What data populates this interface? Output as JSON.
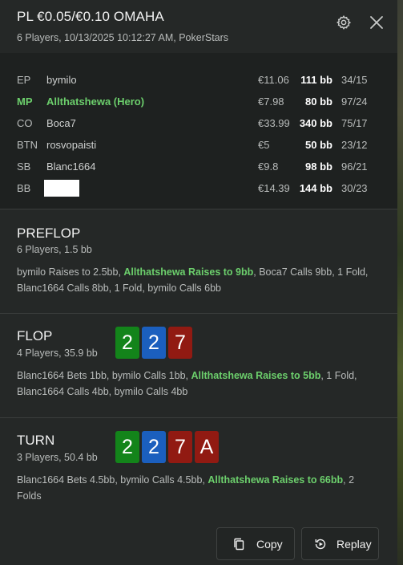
{
  "header": {
    "title": "PL €0.05/€0.10 OMAHA",
    "subtitle": "6 Players, 10/13/2025 10:12:27 AM, PokerStars"
  },
  "players": [
    {
      "position": "EP",
      "name": "bymilo",
      "stack": "€11.06",
      "bb": "111 bb",
      "stats": "34/15",
      "hero": false
    },
    {
      "position": "MP",
      "name": "Allthatshewa (Hero)",
      "stack": "€7.98",
      "bb": "80 bb",
      "stats": "97/24",
      "hero": true
    },
    {
      "position": "CO",
      "name": "Boca7",
      "stack": "€33.99",
      "bb": "340 bb",
      "stats": "75/17",
      "hero": false
    },
    {
      "position": "BTN",
      "name": "rosvopaisti",
      "stack": "€5",
      "bb": "50 bb",
      "stats": "23/12",
      "hero": false
    },
    {
      "position": "SB",
      "name": "Blanc1664",
      "stack": "€9.8",
      "bb": "98 bb",
      "stats": "96/21",
      "hero": false
    },
    {
      "position": "BB",
      "name": "",
      "stack": "€14.39",
      "bb": "144 bb",
      "stats": "30/23",
      "hero": false
    }
  ],
  "preflop": {
    "name": "PREFLOP",
    "info": "6 Players, 1.5 bb",
    "action_1": "bymilo Raises to 2.5bb, ",
    "hero_action": "Allthatshewa Raises to 9bb",
    "action_2": ", Boca7 Calls 9bb, 1 Fold, Blanc1664 Calls 8bb, 1 Fold, bymilo Calls 6bb"
  },
  "flop": {
    "name": "FLOP",
    "info": "4 Players, 35.9 bb",
    "cards": [
      {
        "rank": "2",
        "suit": "club",
        "color": "#13841a"
      },
      {
        "rank": "2",
        "suit": "diamond",
        "color": "#1b5fbe"
      },
      {
        "rank": "7",
        "suit": "heart",
        "color": "#911a12"
      }
    ],
    "action_1": "Blanc1664 Bets 1bb, bymilo Calls 1bb, ",
    "hero_action": "Allthatshewa Raises to 5bb",
    "action_2": ", 1 Fold, Blanc1664 Calls 4bb, bymilo Calls 4bb"
  },
  "turn": {
    "name": "TURN",
    "info": "3 Players, 50.4 bb",
    "cards": [
      {
        "rank": "2",
        "suit": "club",
        "color": "#13841a"
      },
      {
        "rank": "2",
        "suit": "diamond",
        "color": "#1b5fbe"
      },
      {
        "rank": "7",
        "suit": "heart",
        "color": "#911a12"
      },
      {
        "rank": "A",
        "suit": "heart",
        "color": "#911a12"
      }
    ],
    "action_1": "Blanc1664 Bets 4.5bb, bymilo Calls 4.5bb, ",
    "hero_action": "Allthatshewa Raises to 66bb",
    "action_2": ", 2 Folds"
  },
  "buttons": {
    "copy": "Copy",
    "replay": "Replay"
  },
  "colors": {
    "hero": "#6ccf6c",
    "background": "#252827",
    "players_bg": "#1e2120"
  },
  "icons": {
    "settings": "gear-icon",
    "close": "close-icon",
    "copy": "copy-icon",
    "replay": "replay-icon"
  }
}
